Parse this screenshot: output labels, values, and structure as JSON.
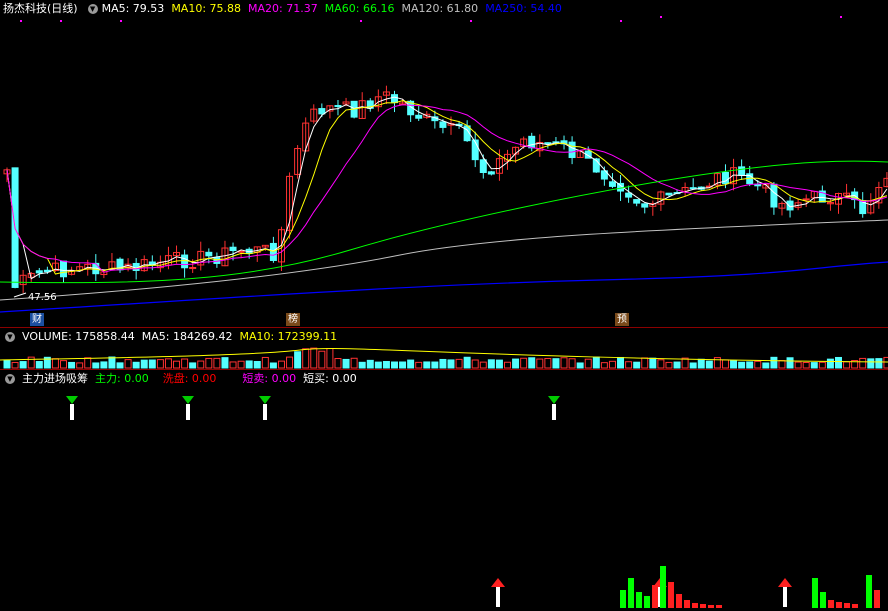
{
  "main_chart": {
    "title": "扬杰科技(日线)",
    "indicators": [
      {
        "label": "MA5: 79.53",
        "color": "#ffffff"
      },
      {
        "label": "MA10: 75.88",
        "color": "#ffff00"
      },
      {
        "label": "MA20: 71.37",
        "color": "#ff00ff"
      },
      {
        "label": "MA60: 66.16",
        "color": "#00ff00"
      },
      {
        "label": "MA120: 61.80",
        "color": "#c0c0c0"
      },
      {
        "label": "MA250: 54.40",
        "color": "#0000ff"
      }
    ],
    "low_price_label": "47.56",
    "event_marks": [
      "财",
      "榜",
      "预"
    ]
  },
  "volume_panel": {
    "indicators": [
      {
        "label": "VOLUME: 175858.44",
        "color": "#ffffff"
      },
      {
        "label": "MA5: 184269.42",
        "color": "#ffffff"
      },
      {
        "label": "MA10: 172399.11",
        "color": "#ffff00"
      }
    ]
  },
  "signal_panel": {
    "indicators": [
      {
        "label": "主力进场吸筹",
        "color": "#ffffff"
      },
      {
        "label": "主力: 0.00",
        "color": "#00ff00"
      },
      {
        "label": "洗盘: 0.00",
        "color": "#ff0000"
      },
      {
        "label": "短卖: 0.00",
        "color": "#ff00ff"
      },
      {
        "label": "短买: 0.00",
        "color": "#ffffff"
      }
    ]
  },
  "colors": {
    "up": "#ff3232",
    "down": "#54ffff",
    "ma5": "#ffffff",
    "ma10": "#ffff00",
    "ma20": "#ff00ff",
    "ma60": "#00ff00",
    "ma120": "#c0c0c0",
    "ma250": "#0000ff",
    "grid": "#8b0000"
  }
}
